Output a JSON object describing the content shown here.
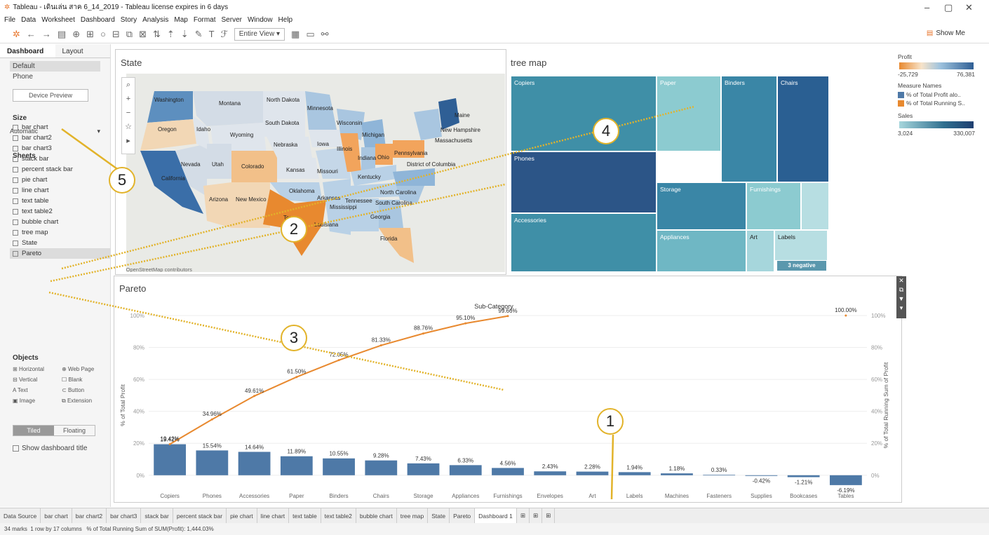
{
  "window": {
    "title": "Tableau - เดินเล่น สาค 6_14_2019 - Tableau license expires in 6 days"
  },
  "menu": [
    "File",
    "Data",
    "Worksheet",
    "Dashboard",
    "Story",
    "Analysis",
    "Map",
    "Format",
    "Server",
    "Window",
    "Help"
  ],
  "toolbar": {
    "fit": "Entire View",
    "show_me": "Show Me"
  },
  "left": {
    "tab_dashboard": "Dashboard",
    "tab_layout": "Layout",
    "device_default": "Default",
    "device_phone": "Phone",
    "device_preview": "Device Preview",
    "size_label": "Size",
    "size_value": "Automatic",
    "sheets_label": "Sheets",
    "sheets": [
      "bar chart",
      "bar chart2",
      "bar chart3",
      "stack bar",
      "percent stack bar",
      "pie chart",
      "line chart",
      "text table",
      "text table2",
      "bubble chart",
      "tree map",
      "State",
      "Pareto"
    ],
    "objects_label": "Objects",
    "objects": [
      "Horizontal",
      "Web Page",
      "Vertical",
      "Blank",
      "Text",
      "Button",
      "Image",
      "Extension"
    ],
    "tiled": "Tiled",
    "floating": "Floating",
    "show_title": "Show dashboard title"
  },
  "state": {
    "title": "State",
    "credit": "© OpenStreetMap contributors",
    "labels": [
      "Washington",
      "Montana",
      "North Dakota",
      "Minnesota",
      "Oregon",
      "Idaho",
      "South Dakota",
      "Wisconsin",
      "Michigan",
      "Maine",
      "Wyoming",
      "Nebraska",
      "Iowa",
      "New Hampshire",
      "Massachusetts",
      "Nevada",
      "Utah",
      "Colorado",
      "Kansas",
      "Missouri",
      "Illinois",
      "Indiana",
      "Ohio",
      "Pennsylvania",
      "District of Columbia",
      "California",
      "Kentucky",
      "North Carolina",
      "Oklahoma",
      "Arkansas",
      "Arizona",
      "New Mexico",
      "Tennessee",
      "South Carolina",
      "Mississippi",
      "Georgia",
      "Louisiana",
      "Florida",
      "Texas"
    ]
  },
  "tree": {
    "title": "tree map",
    "cells": [
      "Copiers",
      "Paper",
      "Binders",
      "Chairs",
      "Phones",
      "Storage",
      "Furnishings",
      "Accessories",
      "Appliances",
      "Art",
      "Labels"
    ],
    "negative": "3 negative"
  },
  "legend": {
    "profit": "Profit",
    "profit_min": "-25,729",
    "profit_max": "76,381",
    "measure_names": "Measure Names",
    "m1": "% of Total Profit alo..",
    "m2": "% of Total Running S..",
    "sales": "Sales",
    "sales_min": "3,024",
    "sales_max": "330,007",
    "colors": {
      "orange": "#e8892f",
      "blue": "#4e79a7",
      "teal": "#2f6f8f"
    }
  },
  "pareto": {
    "title": "Pareto",
    "header": "Sub-Category",
    "ylabel_left": "% of Total Profit",
    "ylabel_right": "% of Total Running Sum of Profit"
  },
  "chart_data": {
    "type": "bar",
    "categories": [
      "Copiers",
      "Phones",
      "Accessories",
      "Paper",
      "Binders",
      "Chairs",
      "Storage",
      "Appliances",
      "Furnishings",
      "Envelopes",
      "Art",
      "Labels",
      "Machines",
      "Fasteners",
      "Supplies",
      "Bookcases",
      "Tables"
    ],
    "series": [
      {
        "name": "% of Total Profit",
        "values": [
          19.42,
          15.54,
          14.64,
          11.89,
          10.55,
          9.28,
          7.43,
          6.33,
          4.56,
          2.43,
          2.28,
          1.94,
          1.18,
          0.33,
          -0.42,
          -1.21,
          -6.19
        ]
      },
      {
        "name": "% of Total Running Sum of Profit",
        "values": [
          19.42,
          34.96,
          49.61,
          61.5,
          72.05,
          81.33,
          88.76,
          95.1,
          99.66,
          null,
          null,
          null,
          null,
          null,
          null,
          null,
          100.0
        ]
      }
    ],
    "yticks": [
      "0%",
      "20%",
      "40%",
      "60%",
      "80%",
      "100%"
    ],
    "ylim": [
      -8,
      100
    ]
  },
  "callouts": [
    "1",
    "2",
    "3",
    "4",
    "5"
  ],
  "status": {
    "tabs": [
      "Data Source",
      "bar chart",
      "bar chart2",
      "bar chart3",
      "stack bar",
      "percent stack bar",
      "pie chart",
      "line chart",
      "text table",
      "text table2",
      "bubble chart",
      "tree map",
      "State",
      "Pareto",
      "Dashboard 1"
    ],
    "marks": "34 marks",
    "rows": "1 row by 17 columns",
    "sum": "% of Total Running Sum of SUM(Profit): 1,444.03%"
  }
}
